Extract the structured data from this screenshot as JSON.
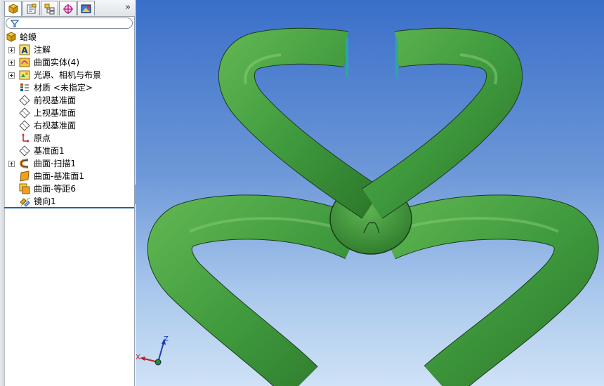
{
  "feature_manager": {
    "tabs": [
      {
        "name": "feature-manager-tab",
        "icon": "feature-tree-icon"
      },
      {
        "name": "property-manager-tab",
        "icon": "property-manager-icon"
      },
      {
        "name": "configuration-manager-tab",
        "icon": "configuration-manager-icon"
      },
      {
        "name": "dim-xpert-tab",
        "icon": "target-crosshair-icon"
      },
      {
        "name": "display-manager-tab",
        "icon": "display-manager-icon"
      }
    ],
    "more_tabs_glyph": "»",
    "filter_icon": "filter-icon",
    "tree": {
      "root": {
        "label": "蛤蟆",
        "icon": "part-icon"
      },
      "items": [
        {
          "label": "注解",
          "icon": "annotation-icon",
          "expandable": true
        },
        {
          "label": "曲面实体(4)",
          "icon": "surface-bodies-icon",
          "expandable": true
        },
        {
          "label": "光源、相机与布景",
          "icon": "lights-cameras-icon",
          "expandable": true
        },
        {
          "label": "材质 <未指定>",
          "icon": "material-icon",
          "expandable": false
        },
        {
          "label": "前视基准面",
          "icon": "plane-icon",
          "expandable": false
        },
        {
          "label": "上视基准面",
          "icon": "plane-icon",
          "expandable": false
        },
        {
          "label": "右视基准面",
          "icon": "plane-icon",
          "expandable": false
        },
        {
          "label": "原点",
          "icon": "origin-icon",
          "expandable": false
        },
        {
          "label": "基准面1",
          "icon": "plane-icon",
          "expandable": false
        },
        {
          "label": "曲面-扫描1",
          "icon": "sweep-surface-icon",
          "expandable": true
        },
        {
          "label": "曲面-基准面1",
          "icon": "planar-surface-icon",
          "expandable": false
        },
        {
          "label": "曲面-等距6",
          "icon": "offset-surface-icon",
          "expandable": false
        },
        {
          "label": "镜向1",
          "icon": "mirror-icon",
          "expandable": false
        }
      ]
    }
  },
  "viewport": {
    "triad_axes": {
      "x": "X",
      "z": "Z"
    },
    "model_color": "#3f9a3d",
    "model_dark": "#2b6e2a",
    "model_light": "#8fd07e"
  },
  "colors": {
    "accent": "#1f5faa",
    "sky_top": "#3a6fc9",
    "sky_bottom": "#cfe2f6"
  }
}
